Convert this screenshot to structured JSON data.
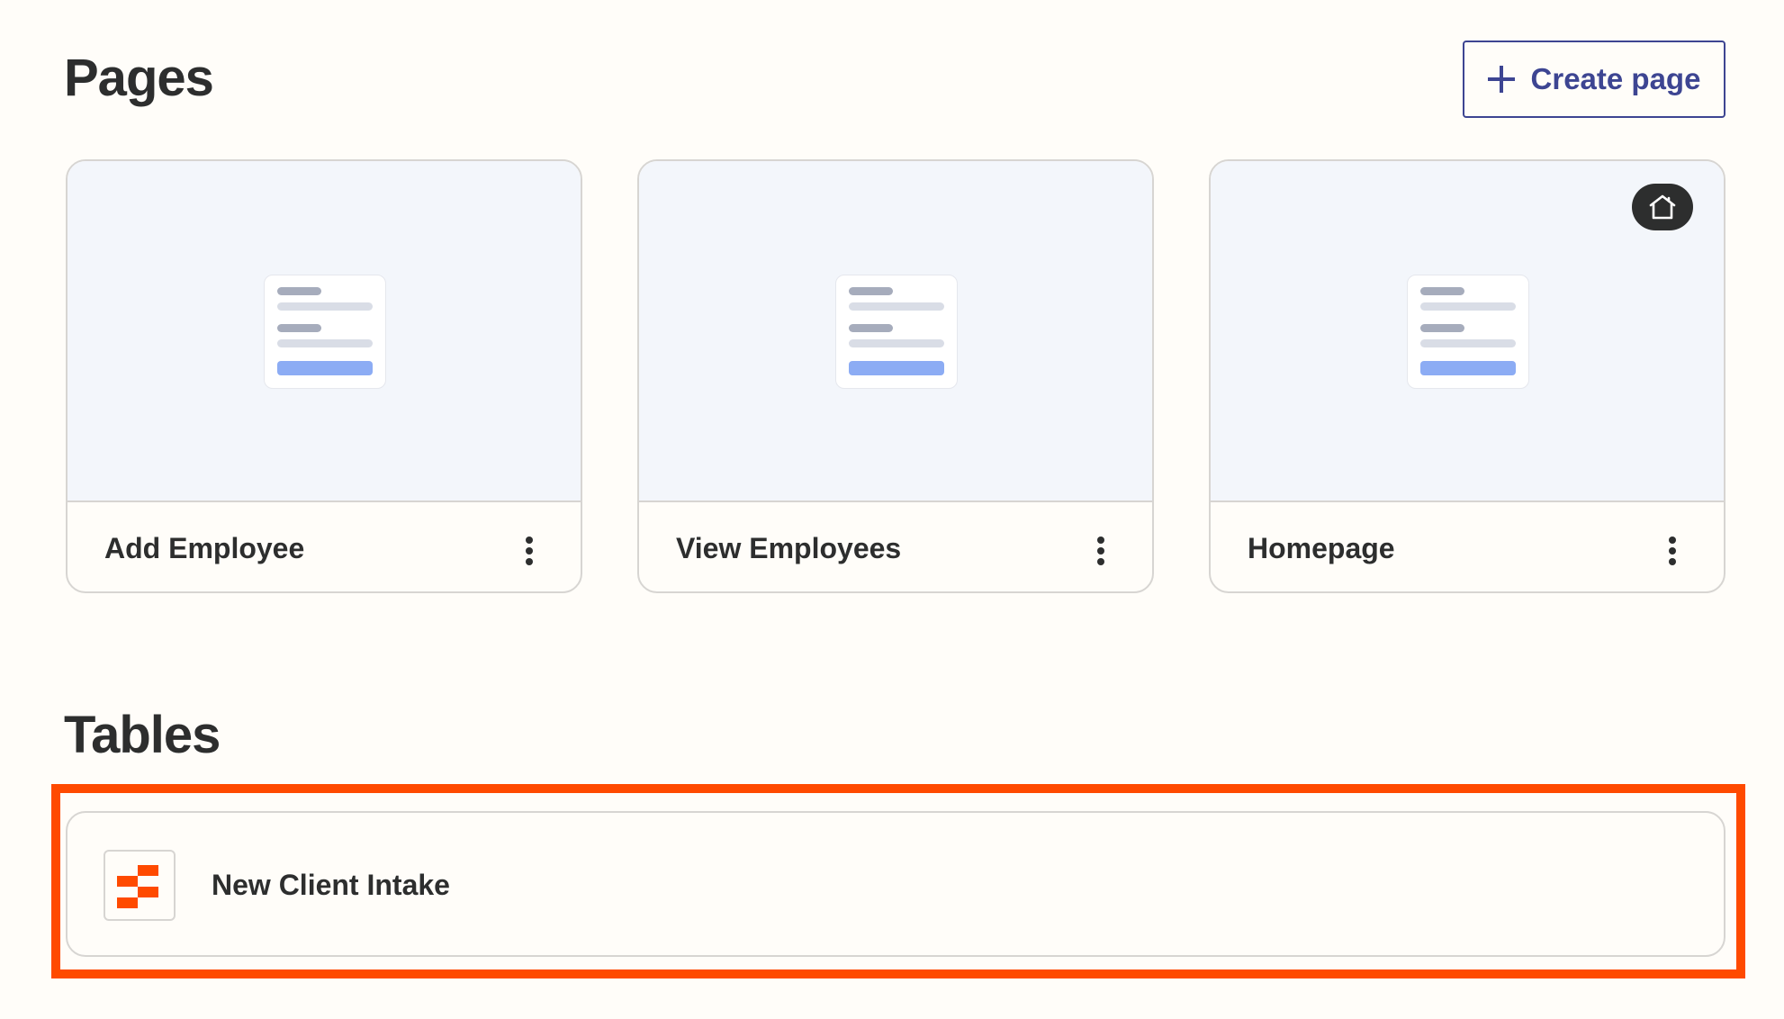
{
  "pages_section": {
    "title": "Pages",
    "create_button": {
      "label": "Create page",
      "icon": "plus-icon"
    },
    "cards": [
      {
        "name": "Add Employee",
        "is_homepage": false,
        "menu_icon": "more-vertical-icon"
      },
      {
        "name": "View Employees",
        "is_homepage": false,
        "menu_icon": "more-vertical-icon"
      },
      {
        "name": "Homepage",
        "is_homepage": true,
        "badge_icon": "home-icon",
        "menu_icon": "more-vertical-icon"
      }
    ]
  },
  "tables_section": {
    "title": "Tables",
    "items": [
      {
        "name": "New Client Intake",
        "icon": "zapier-tables-icon",
        "highlighted": true
      }
    ]
  },
  "colors": {
    "background": "#fffdf9",
    "text": "#2d2e2e",
    "accent_button": "#3d4592",
    "highlight": "#ff4a00",
    "tables_icon": "#ff4a00",
    "thumbnail_bg": "#f3f6fb",
    "card_border": "#d7d5d2"
  }
}
